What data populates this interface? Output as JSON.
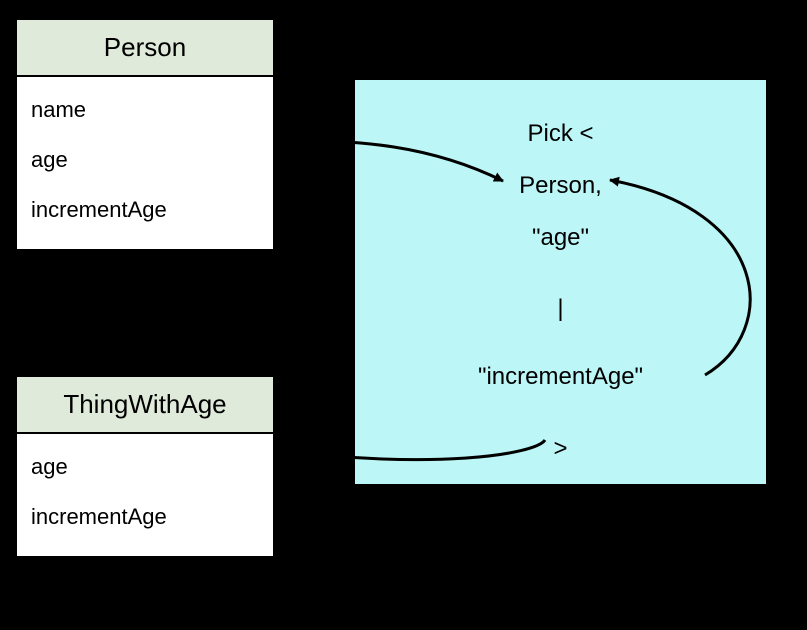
{
  "classes": {
    "person": {
      "title": "Person",
      "members": [
        "name",
        "age",
        "incrementAge"
      ]
    },
    "thingWithAge": {
      "title": "ThingWithAge",
      "members": [
        "age",
        "incrementAge"
      ]
    }
  },
  "pick": {
    "line1": "Pick <",
    "line2": "Person,",
    "line3": "\"age\"",
    "line4": "|",
    "line5": "\"incrementAge\"",
    "line6": ">"
  },
  "colors": {
    "background": "#000000",
    "classBg": "#ffffff",
    "classHeaderBg": "#dfeada",
    "pickBg": "#bdf6f6",
    "border": "#000000"
  }
}
